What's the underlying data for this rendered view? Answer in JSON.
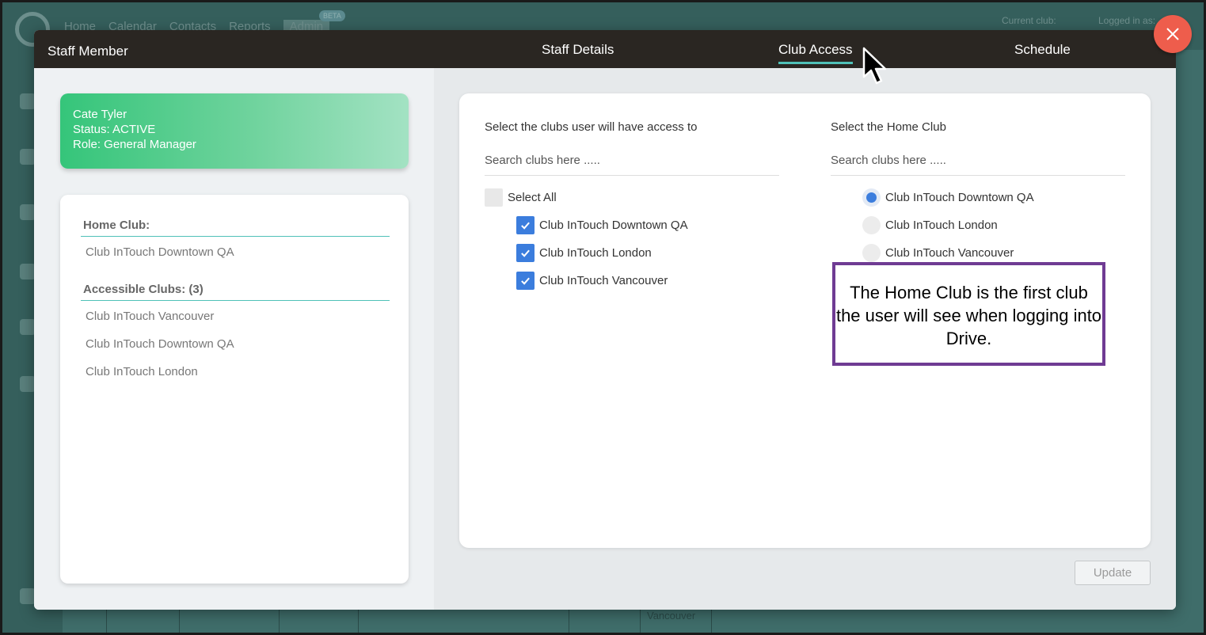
{
  "background": {
    "nav": [
      "Home",
      "Calendar",
      "Contacts",
      "Reports",
      "Admin"
    ],
    "beta_badge": "BETA",
    "current_club_label": "Current club:",
    "logged_in_label": "Logged in as:",
    "table_cell": "Vancouver"
  },
  "modal": {
    "title": "Staff Member",
    "tabs": [
      {
        "label": "Staff Details",
        "active": false
      },
      {
        "label": "Club Access",
        "active": true
      },
      {
        "label": "Schedule",
        "active": false
      }
    ]
  },
  "staff_card": {
    "name": "Cate Tyler",
    "status": "Status: ACTIVE",
    "role": "Role: General Manager"
  },
  "info_card": {
    "home_club_heading": "Home Club:",
    "home_club": "Club InTouch Downtown QA",
    "accessible_heading": "Accessible Clubs: (3)",
    "accessible_clubs": [
      "Club InTouch Vancouver",
      "Club InTouch Downtown QA",
      "Club InTouch London"
    ]
  },
  "access": {
    "clubs_label": "Select the clubs user will have access to",
    "clubs_search_placeholder": "Search clubs here .....",
    "select_all_label": "Select All",
    "clubs": [
      {
        "name": "Club InTouch Downtown QA",
        "checked": true
      },
      {
        "name": "Club InTouch London",
        "checked": true
      },
      {
        "name": "Club InTouch Vancouver",
        "checked": true
      }
    ],
    "home_label": "Select the Home Club",
    "home_search_placeholder": "Search clubs here .....",
    "home_options": [
      {
        "name": "Club InTouch Downtown QA",
        "selected": true
      },
      {
        "name": "Club InTouch London",
        "selected": false
      },
      {
        "name": "Club InTouch Vancouver",
        "selected": false
      }
    ],
    "update_label": "Update"
  },
  "callout": {
    "text": "The Home Club is the first club the user will see when logging into Drive."
  },
  "colors": {
    "header": "#2a2622",
    "accent": "#4fc1b8",
    "checkbox": "#3b7ddd",
    "close": "#ee5d4c",
    "callout_border": "#6f3b93"
  }
}
